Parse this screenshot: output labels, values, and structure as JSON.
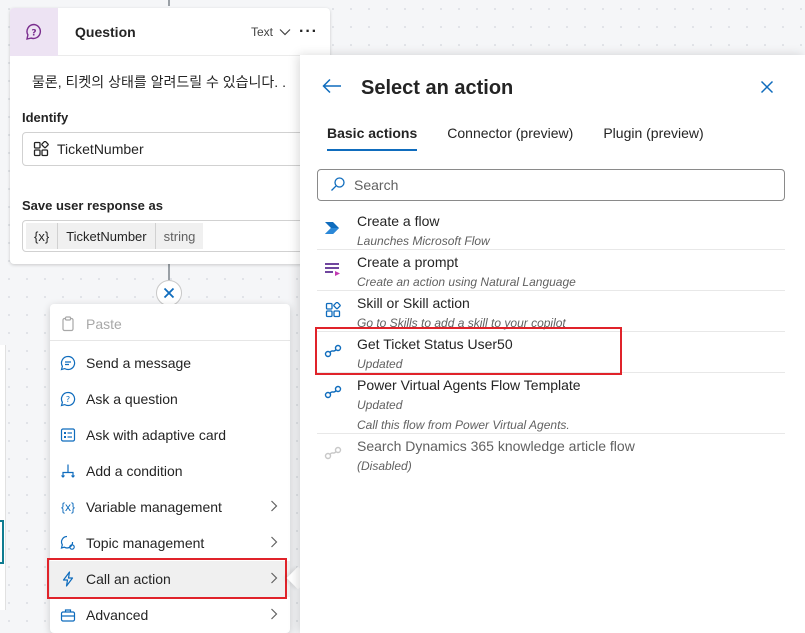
{
  "question_card": {
    "title": "Question",
    "type_label": "Text",
    "more_label": "···",
    "message": "물론, 티켓의 상태를 알려드릴 수 있습니다. .",
    "identify_label": "Identify",
    "identify_value": "TicketNumber",
    "save_label": "Save user response as",
    "var_symbol": "{x}",
    "var_name": "TicketNumber",
    "var_type": "string"
  },
  "add_node_icon": "close-icon",
  "menu": {
    "items": [
      {
        "label": "Paste",
        "icon": "clipboard-icon",
        "disabled": true,
        "submenu": false
      },
      {
        "label": "Send a message",
        "icon": "message-icon",
        "disabled": false,
        "submenu": false
      },
      {
        "label": "Ask a question",
        "icon": "question-icon",
        "disabled": false,
        "submenu": false
      },
      {
        "label": "Ask with adaptive card",
        "icon": "card-icon",
        "disabled": false,
        "submenu": false
      },
      {
        "label": "Add a condition",
        "icon": "branch-icon",
        "disabled": false,
        "submenu": false
      },
      {
        "label": "Variable management",
        "icon": "variable-icon",
        "disabled": false,
        "submenu": true
      },
      {
        "label": "Topic management",
        "icon": "topic-icon",
        "disabled": false,
        "submenu": true
      },
      {
        "label": "Call an action",
        "icon": "lightning-icon",
        "disabled": false,
        "submenu": true,
        "active": true
      },
      {
        "label": "Advanced",
        "icon": "toolbox-icon",
        "disabled": false,
        "submenu": true
      }
    ]
  },
  "panel": {
    "title": "Select an action",
    "tabs": [
      "Basic actions",
      "Connector (preview)",
      "Plugin (preview)"
    ],
    "active_tab": "Basic actions",
    "search_placeholder": "Search",
    "actions": [
      {
        "title": "Create a flow",
        "subtitle": "Launches Microsoft Flow",
        "icon": "power-automate-icon"
      },
      {
        "title": "Create a prompt",
        "subtitle": "Create an action using Natural Language",
        "icon": "prompt-icon"
      },
      {
        "title": "Skill or Skill action",
        "subtitle": "Go to Skills to add a skill to your copilot",
        "icon": "skill-icon"
      },
      {
        "title": "Get Ticket Status User50",
        "subtitle": "Updated",
        "icon": "flow-link-icon",
        "highlighted": true
      },
      {
        "title": "Power Virtual Agents Flow Template",
        "subtitle": "Updated",
        "subtitle2": "Call this flow from Power Virtual Agents.",
        "icon": "flow-link-icon"
      },
      {
        "title": "Search Dynamics 365 knowledge article flow",
        "subtitle": "(Disabled)",
        "icon": "flow-link-icon",
        "disabled": true
      }
    ]
  },
  "colors": {
    "accent": "#0f6cbd",
    "highlight": "#e0232a",
    "question_icon_bg": "#ede3f3"
  }
}
